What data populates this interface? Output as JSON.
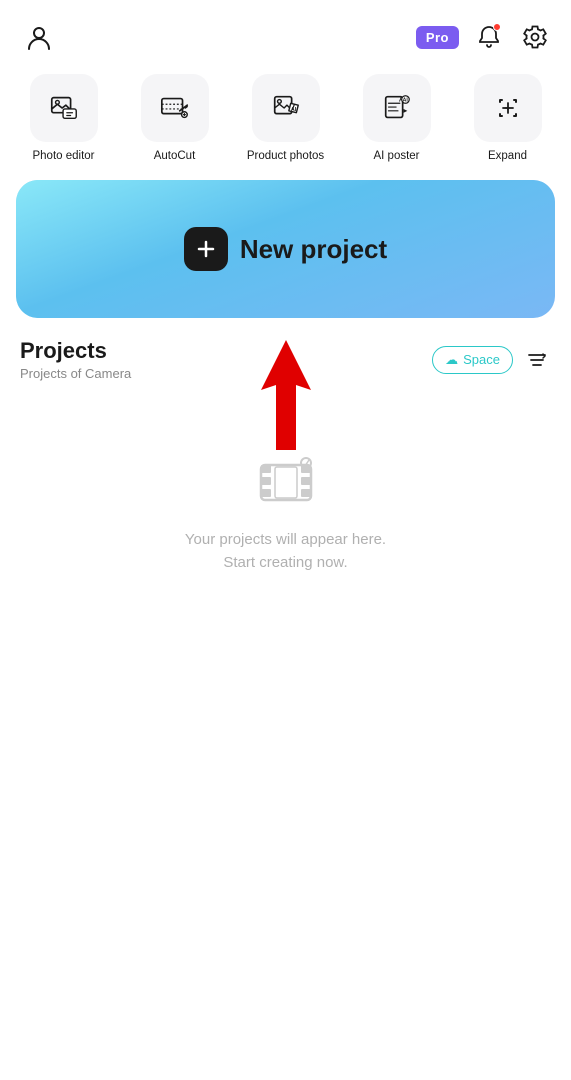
{
  "header": {
    "pro_label": "Pro",
    "bell_icon": "bell-icon",
    "settings_icon": "settings-icon",
    "user_icon": "user-icon"
  },
  "tools": [
    {
      "id": "photo-editor",
      "label": "Photo editor",
      "icon": "photo-editor-icon"
    },
    {
      "id": "autocut",
      "label": "AutoCut",
      "icon": "autocut-icon"
    },
    {
      "id": "product-photos",
      "label": "Product photos",
      "icon": "product-photos-icon"
    },
    {
      "id": "ai-poster",
      "label": "AI poster",
      "icon": "ai-poster-icon"
    },
    {
      "id": "expand",
      "label": "Expand",
      "icon": "expand-icon"
    }
  ],
  "new_project": {
    "label": "New project",
    "icon": "plus-icon"
  },
  "projects": {
    "title": "Projects",
    "subtitle": "Projects of Camera",
    "space_button": "Space",
    "empty_text": "Your projects will appear here.\nStart creating now."
  }
}
